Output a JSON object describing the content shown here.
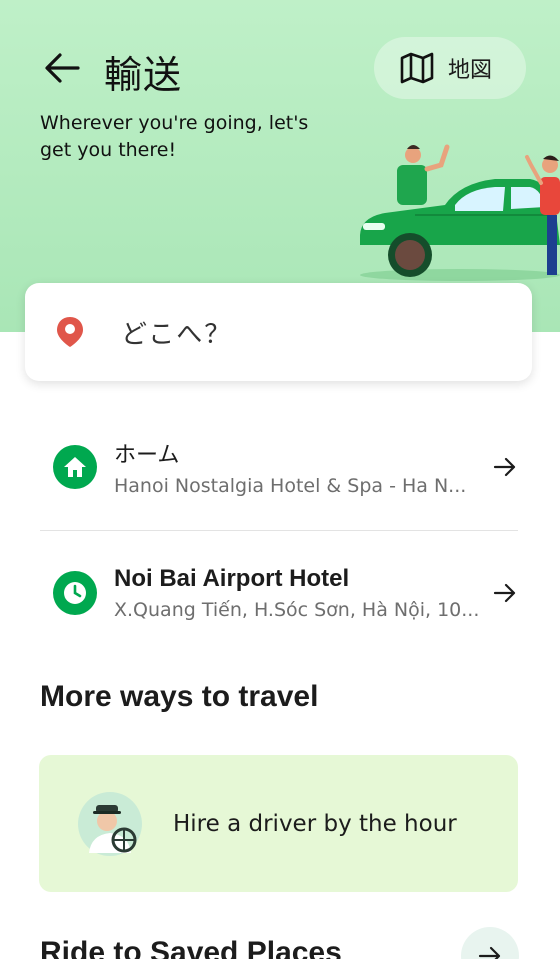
{
  "header": {
    "title": "輸送",
    "map_label": "地図",
    "subtitle": "Wherever you're going, let's get you there!"
  },
  "search": {
    "placeholder": "どこへ？"
  },
  "saved_places": [
    {
      "name": "ホーム",
      "address": "Hanoi Nostalgia Hotel & Spa - Ha N...",
      "icon": "home-icon"
    },
    {
      "name": "Noi Bai Airport Hotel",
      "address": "X.Quang Tiến, H.Sóc Sơn, Hà Nội, 10...",
      "icon": "clock-icon"
    }
  ],
  "more_ways": {
    "heading": "More ways to travel",
    "hire_driver_label": "Hire a driver by the hour"
  },
  "saved_section": {
    "heading": "Ride to Saved Places"
  },
  "colors": {
    "brand_green": "#00a84f",
    "hero_bg": "#b5ebc0",
    "pin_red": "#e0564a",
    "card_bg": "#e6f8d6"
  }
}
